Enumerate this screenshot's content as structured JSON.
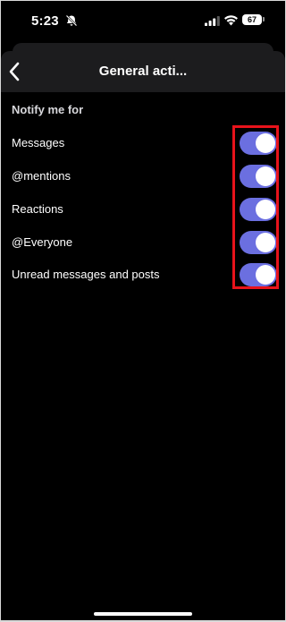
{
  "status_bar": {
    "time": "5:23",
    "battery": "67"
  },
  "header": {
    "title": "General acti..."
  },
  "section": {
    "title": "Notify me for"
  },
  "settings": [
    {
      "label": "Messages",
      "enabled": true
    },
    {
      "label": "@mentions",
      "enabled": true
    },
    {
      "label": "Reactions",
      "enabled": true
    },
    {
      "label": "@Everyone",
      "enabled": true
    },
    {
      "label": "Unread messages and posts",
      "enabled": true
    }
  ],
  "colors": {
    "background": "#000000",
    "header": "#1c1c1e",
    "toggle_on": "#6b6fe0",
    "highlight": "#e8131b"
  }
}
